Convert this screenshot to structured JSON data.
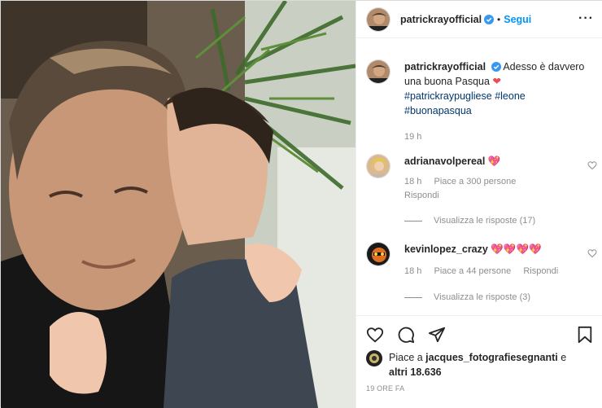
{
  "post": {
    "author": "patrickrayofficial",
    "follow_label": "Segui",
    "more_icon": "more-dots-icon",
    "caption": {
      "text": "Adesso è davvero una buona Pasqua",
      "emoji": "❤",
      "hashtags": [
        "#patrickraypugliese",
        "#leone",
        "#buonapasqua"
      ],
      "time": "19 h"
    }
  },
  "comments": [
    {
      "user": "adrianavolpereal",
      "text": "💖",
      "time": "18 h",
      "likes": "Piace a 300 persone",
      "reply": "Rispondi",
      "view_replies": "Visualizza le risposte (17)"
    },
    {
      "user": "kevinlopez_crazy",
      "text": "💖💖💖💖",
      "time": "18 h",
      "likes": "Piace a 44 persone",
      "reply": "Rispondi",
      "view_replies": "Visualizza le risposte (3)"
    }
  ],
  "actions": {
    "icons": [
      "heart-icon",
      "comment-icon",
      "share-icon",
      "bookmark-icon"
    ],
    "liked_by_prefix": "Piace a ",
    "liked_by_user": "jacques_fotografiesegnanti",
    "liked_by_suffix": " e",
    "liked_by_others": "altri 18.636",
    "post_time": "19 ORE FA"
  },
  "colors": {
    "link_blue": "#0095f6",
    "hashtag": "#00376b",
    "muted": "#8e8e8e",
    "heart_red": "#ed4956"
  }
}
